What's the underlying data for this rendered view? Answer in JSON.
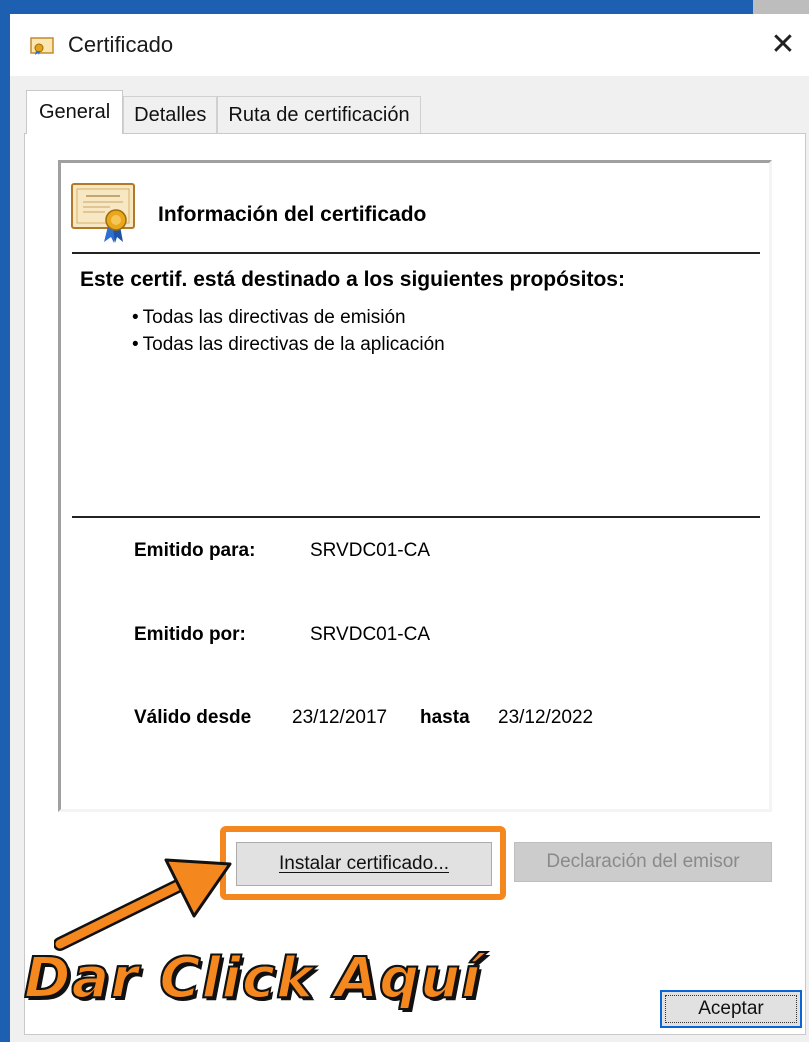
{
  "window": {
    "title": "Certificado",
    "close_glyph": "✕"
  },
  "tabs": [
    {
      "label": "General",
      "active": true
    },
    {
      "label": "Detalles",
      "active": false
    },
    {
      "label": "Ruta de certificación",
      "active": false
    }
  ],
  "info": {
    "title": "Información del certificado",
    "purposes_heading": "Este certif. está destinado a los siguientes propósitos:",
    "purposes": [
      "Todas las directivas de emisión",
      "Todas las directivas de la aplicación"
    ],
    "issued_to_label": "Emitido para:",
    "issued_to_value": "SRVDC01-CA",
    "issued_by_label": "Emitido por:",
    "issued_by_value": "SRVDC01-CA",
    "valid_from_label": "Válido desde",
    "valid_from_value": "23/12/2017",
    "valid_to_label": "hasta",
    "valid_to_value": "23/12/2022"
  },
  "buttons": {
    "install": "Instalar certificado...",
    "issuer_statement": "Declaración del emisor",
    "accept": "Aceptar"
  },
  "annotation": {
    "callout_text": "Dar Click Aquí",
    "highlight_color": "#f5871f"
  },
  "icons": {
    "title": "certificate-icon",
    "info": "certificate-ribbon-icon",
    "close": "close-icon"
  },
  "colors": {
    "accent_blue": "#1d5fb0",
    "annotation_orange": "#f5871f"
  }
}
